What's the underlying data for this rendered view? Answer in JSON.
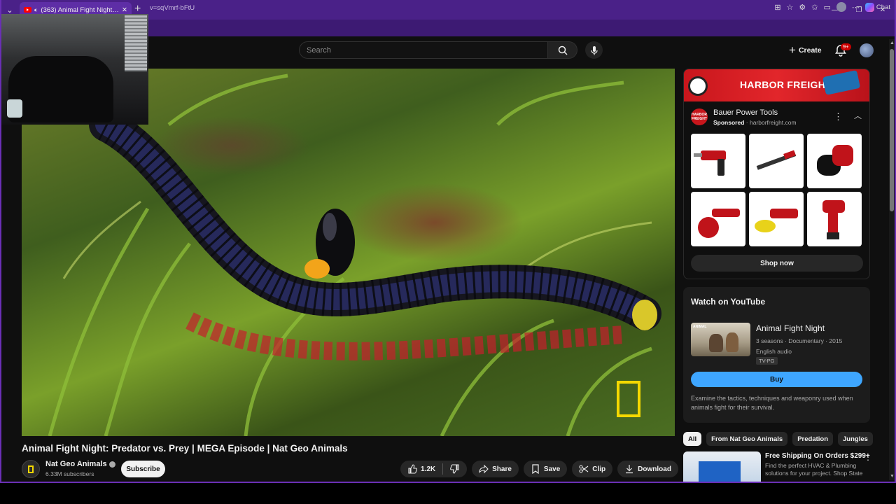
{
  "browser": {
    "tab_title": "(363) Animal Fight Night: Pre",
    "url": "v=sqVmrf-bFtU",
    "copilot_label": "Chat"
  },
  "header": {
    "search_placeholder": "Search",
    "create_label": "Create",
    "notification_count": "9+"
  },
  "video": {
    "title": "Animal Fight Night: Predator vs. Prey | MEGA Episode | Nat Geo Animals",
    "channel_name": "Nat Geo Animals",
    "subscribers": "6.33M subscribers",
    "subscribe_label": "Subscribe",
    "likes": "1.2K",
    "share_label": "Share",
    "save_label": "Save",
    "clip_label": "Clip",
    "download_label": "Download"
  },
  "ad": {
    "banner_text": "HARBOR FREIGHT",
    "icon_text": "HARBOR FREIGHT",
    "advertiser": "Bauer Power Tools",
    "sponsored": "Sponsored",
    "domain": "· harborfreight.com",
    "shop_label": "Shop now",
    "brand_color": "#c8161c"
  },
  "watch_on_youtube": {
    "heading": "Watch on YouTube",
    "thumb_label": "ANIMAL",
    "show_title": "Animal Fight Night",
    "meta": "3 seasons · Documentary · 2015",
    "audio": "English audio",
    "rating": "TV-PG",
    "buy_label": "Buy",
    "description": "Examine the tactics, techniques and weaponry used when animals fight for their survival."
  },
  "chips": [
    "All",
    "From Nat Geo Animals",
    "Predation",
    "Jungles"
  ],
  "shipping_ad": {
    "title": "Free Shipping On Orders $299+",
    "description": "Find the perfect HVAC & Plumbing solutions for your project. Shop State"
  }
}
